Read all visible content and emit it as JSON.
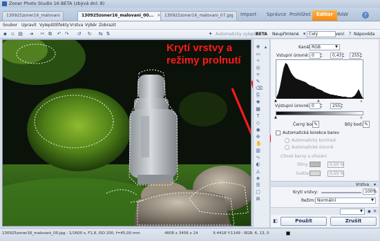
{
  "window": {
    "title": "Zoner Photo Studio 16 BETA (zbývá dní: 8)"
  },
  "doc_tabs": [
    {
      "label": "130925zoner16_malovani"
    },
    {
      "label": "130925zoner16_malovani_00..."
    },
    {
      "label": "130925zoner16_malovani_07.jpg"
    }
  ],
  "modes": {
    "import": "Import",
    "manager": "Správce",
    "viewer": "Prohlížeč",
    "editor": "Editor",
    "raw": "RAW"
  },
  "menu": [
    "Soubor",
    "Upravit",
    "Vylepšit",
    "Efekty",
    "Vrstva",
    "Výběr",
    "Zobrazit"
  ],
  "toolbar": {
    "auto_enhance": "Automaticky vylepšit",
    "beta": "BETA",
    "modified": "Neupřímlené",
    "settings": "Nastavení",
    "help": "Nápověda",
    "zoom": "Celý"
  },
  "annotation": "Krytí vrstvy a režimy prolnutí",
  "panel": {
    "channel_label": "Kanál:",
    "channel_value": "RGB",
    "input_levels_label": "Vstupní úrovně:",
    "input_levels": [
      "0",
      "0,43",
      "255"
    ],
    "output_levels_label": "Výstupní úrovně:",
    "output_levels": [
      "0",
      "255"
    ],
    "black_point": "Černý bod:",
    "white_point": "Bílý bod:",
    "auto_color_correction": "Automatická korekce barev",
    "auto_contrast": "Automatický kontrast",
    "auto_levels": "Automatické úrovně",
    "target_colors": "Cílové barvy a ořezání",
    "shadows_label": "Stíny:",
    "shadows_value": "0,50 %",
    "highlights_label": "Světla:",
    "highlights_value": "0,50 %",
    "layer_section": "Vrstva",
    "opacity_label": "Krytí vrstvy:",
    "opacity_value": "100%",
    "mode_label": "Režim:",
    "mode_value": "Normální",
    "apply": "Použít",
    "cancel": "Zrušit"
  },
  "status": {
    "file_info": "130925zoner16_malovani_00.jpg : 1/1600 s, F1,8, ISO 200, f=45,00 mm",
    "dimensions": "4608 x 3456 x 24",
    "pixel_info": "X:4418 Y:1149 : RGB: 6, 13, 0"
  },
  "histogram": [
    2,
    8,
    18,
    32,
    45,
    52,
    50,
    44,
    38,
    34,
    31,
    29,
    28,
    27,
    26,
    25,
    24,
    22,
    20,
    19,
    18,
    17,
    15,
    14,
    13,
    12,
    10,
    9,
    8,
    7,
    6,
    6,
    5,
    5,
    4,
    4,
    3,
    3,
    3,
    2,
    2,
    2,
    3,
    5,
    9,
    14,
    8,
    2
  ]
}
